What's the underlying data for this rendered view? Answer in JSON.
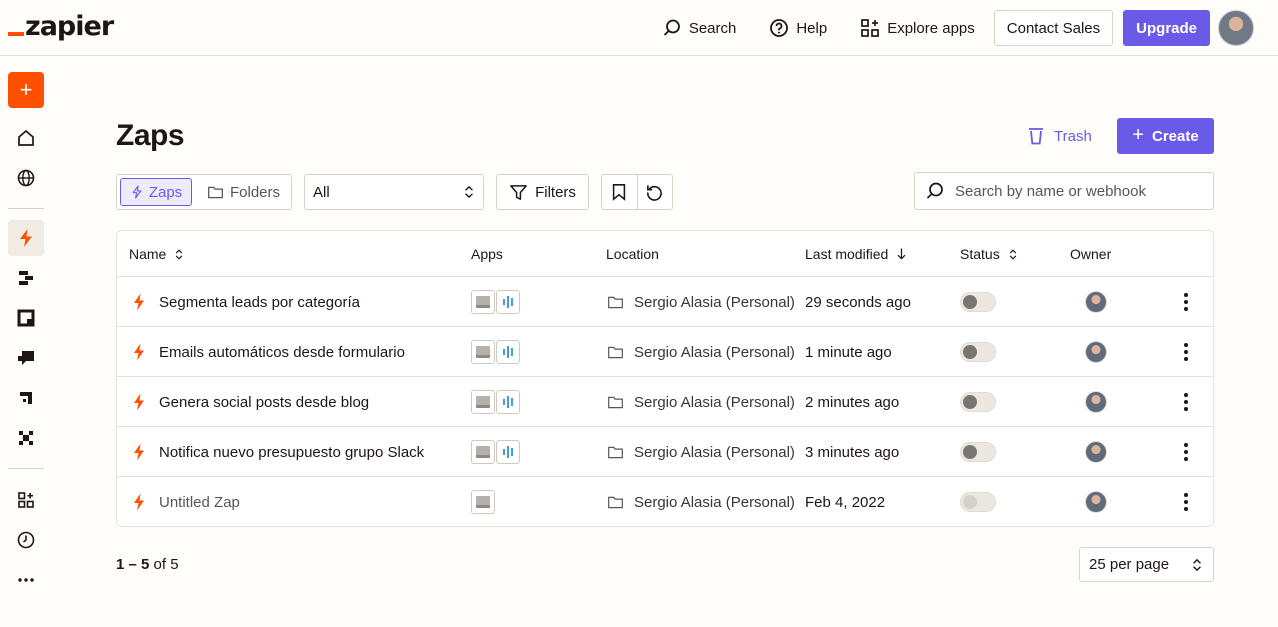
{
  "header": {
    "logo_text": "zapier",
    "nav": [
      {
        "label": "Search",
        "icon": "search-icon"
      },
      {
        "label": "Help",
        "icon": "help-icon"
      },
      {
        "label": "Explore apps",
        "icon": "apps-grid-icon"
      }
    ],
    "contact_sales": "Contact Sales",
    "upgrade": "Upgrade"
  },
  "sidebar": {
    "create_label": "+",
    "items": [
      "home-icon",
      "globe-icon",
      "zap-icon",
      "tables-icon",
      "interfaces-icon",
      "chatbots-icon",
      "canvas-icon",
      "transfer-icon",
      "app-grid-icon",
      "history-icon",
      "more-icon"
    ]
  },
  "page": {
    "title": "Zaps",
    "trash": "Trash",
    "create": "Create"
  },
  "toolbar": {
    "zaps_tab": "Zaps",
    "folders_tab": "Folders",
    "filter_select": "All",
    "filters": "Filters",
    "search_placeholder": "Search by name or webhook"
  },
  "table": {
    "headers": {
      "name": "Name",
      "apps": "Apps",
      "location": "Location",
      "last_modified": "Last modified",
      "status": "Status",
      "owner": "Owner"
    },
    "rows": [
      {
        "name": "Segmenta leads por categoría",
        "location": "Sergio Alasia (Personal)",
        "modified": "29 seconds ago",
        "apps": 2,
        "status": "off"
      },
      {
        "name": "Emails automáticos desde formulario",
        "location": "Sergio Alasia (Personal)",
        "modified": "1 minute ago",
        "apps": 2,
        "status": "off"
      },
      {
        "name": "Genera social posts desde blog",
        "location": "Sergio Alasia (Personal)",
        "modified": "2 minutes ago",
        "apps": 2,
        "status": "off"
      },
      {
        "name": "Notifica nuevo presupuesto grupo Slack",
        "location": "Sergio Alasia (Personal)",
        "modified": "3 minutes ago",
        "apps": 2,
        "status": "off"
      },
      {
        "name": "Untitled Zap",
        "location": "Sergio Alasia (Personal)",
        "modified": "Feb 4, 2022",
        "apps": 1,
        "status": "disabled"
      }
    ]
  },
  "footer": {
    "range": "1 – 5",
    "of_label": "of 5",
    "per_page": "25 per page"
  },
  "colors": {
    "brand": "#ff4f00",
    "accent": "#695be8"
  }
}
